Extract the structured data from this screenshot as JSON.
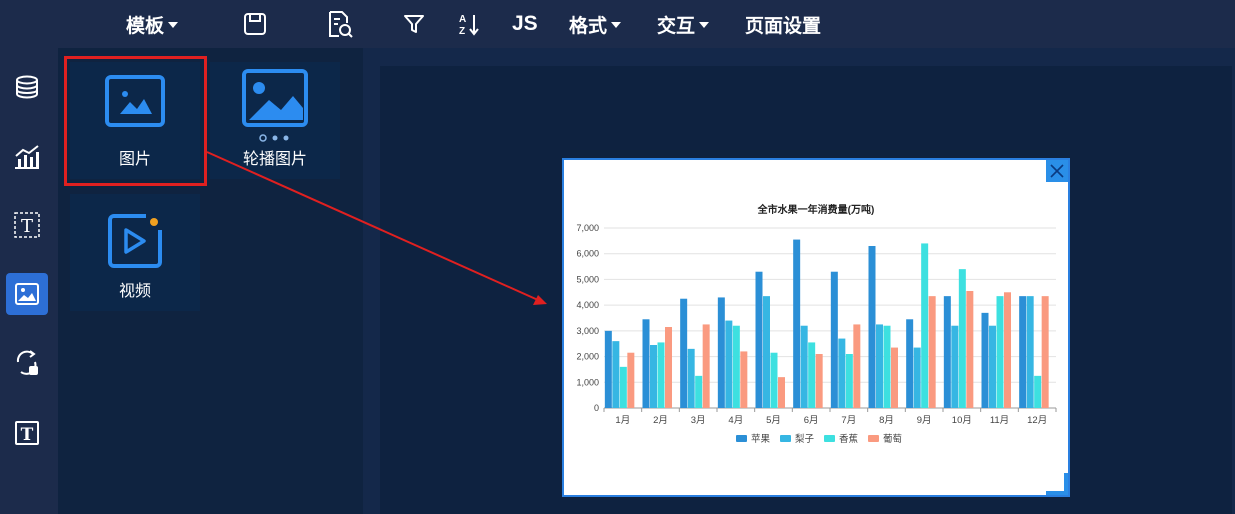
{
  "toolbar": {
    "template_label": "模板",
    "js_label": "JS",
    "format_label": "格式",
    "interact_label": "交互",
    "page_settings_label": "页面设置"
  },
  "panel": {
    "items": [
      {
        "label": "图片",
        "icon": "image-icon"
      },
      {
        "label": "轮播图片",
        "icon": "carousel-image-icon"
      },
      {
        "label": "视频",
        "icon": "video-icon"
      }
    ]
  },
  "rail": {
    "items": [
      "database-icon",
      "chart-icon",
      "text-box-icon",
      "image-icon",
      "interaction-icon",
      "text-icon"
    ],
    "active_index": 3
  },
  "chart_data": {
    "type": "bar",
    "title": "全市水果一年消费量(万吨)",
    "categories": [
      "1月",
      "2月",
      "3月",
      "4月",
      "5月",
      "6月",
      "7月",
      "8月",
      "9月",
      "10月",
      "11月",
      "12月"
    ],
    "ylim": [
      0,
      7000
    ],
    "yticks": [
      "0",
      "1,000",
      "2,000",
      "3,000",
      "4,000",
      "5,000",
      "6,000",
      "7,000"
    ],
    "ytick_values": [
      0,
      1000,
      2000,
      3000,
      4000,
      5000,
      6000,
      7000
    ],
    "grid": true,
    "legend_position": "bottom",
    "series": [
      {
        "name": "苹果",
        "color": "#2b8fd6",
        "values": [
          3000,
          3450,
          4250,
          4300,
          5300,
          6550,
          5300,
          6300,
          3450,
          4350,
          3700,
          4350
        ]
      },
      {
        "name": "梨子",
        "color": "#36b6e3",
        "values": [
          2600,
          2450,
          2300,
          3400,
          4350,
          3200,
          2700,
          3250,
          2350,
          3200,
          3200,
          4350
        ]
      },
      {
        "name": "香蕉",
        "color": "#3de0e0",
        "values": [
          1600,
          2550,
          1250,
          3200,
          2150,
          2550,
          2100,
          3200,
          6400,
          5400,
          4350,
          1250
        ]
      },
      {
        "name": "葡萄",
        "color": "#fa9a80",
        "values": [
          2150,
          3150,
          3250,
          2200,
          1200,
          2100,
          3250,
          2350,
          4350,
          4550,
          4500,
          4350
        ]
      }
    ]
  }
}
